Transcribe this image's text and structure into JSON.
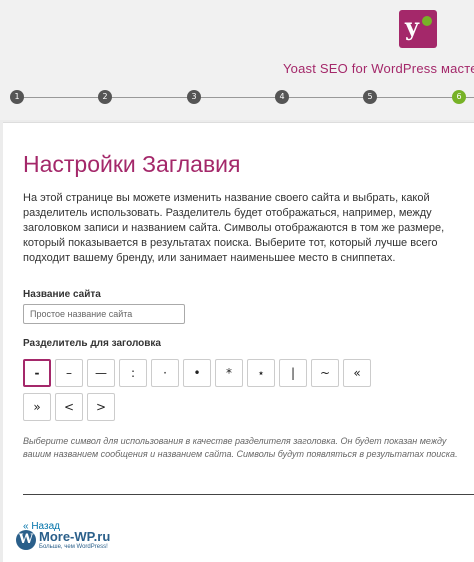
{
  "header": {
    "app_title": "Yoast SEO for WordPress масте",
    "steps": [
      "1",
      "2",
      "3",
      "4",
      "5",
      "6"
    ],
    "active_step": "6",
    "brand_color": "#a4286a",
    "accent_color": "#77b227"
  },
  "page": {
    "title": "Настройки Заглавия",
    "intro": "На этой странице вы можете изменить название своего сайта и выбрать, какой разделитель использовать. Разделитель будет отображаться, например, между заголовком записи и названием сайта. Символы отображаются в том же размере, который показывается в результатах поиска. Выберите тот, который лучше всего подходит вашему бренду, или занимает наименьшее место в сниппетах.",
    "site_name_label": "Название сайта",
    "site_name_placeholder": "Простое название сайта",
    "separator_label": "Разделитель для заголовка",
    "separators": [
      "-",
      "–",
      "—",
      ":",
      "·",
      "•",
      "*",
      "⋆",
      "|",
      "~",
      "«",
      "»",
      "<",
      ">"
    ],
    "selected_separator": "-",
    "hint": "Выберите символ для использования в качестве разделителя заголовка. Он будет показан между вашим названием сообщения и названием сайта. Символы будут появляться в результатах поиска.",
    "back_label": "« Назад"
  },
  "watermark": {
    "logo_icon": "wordpress-logo-icon",
    "title": "More-WP.ru",
    "subtitle": "Больше, чем WordPress!"
  }
}
